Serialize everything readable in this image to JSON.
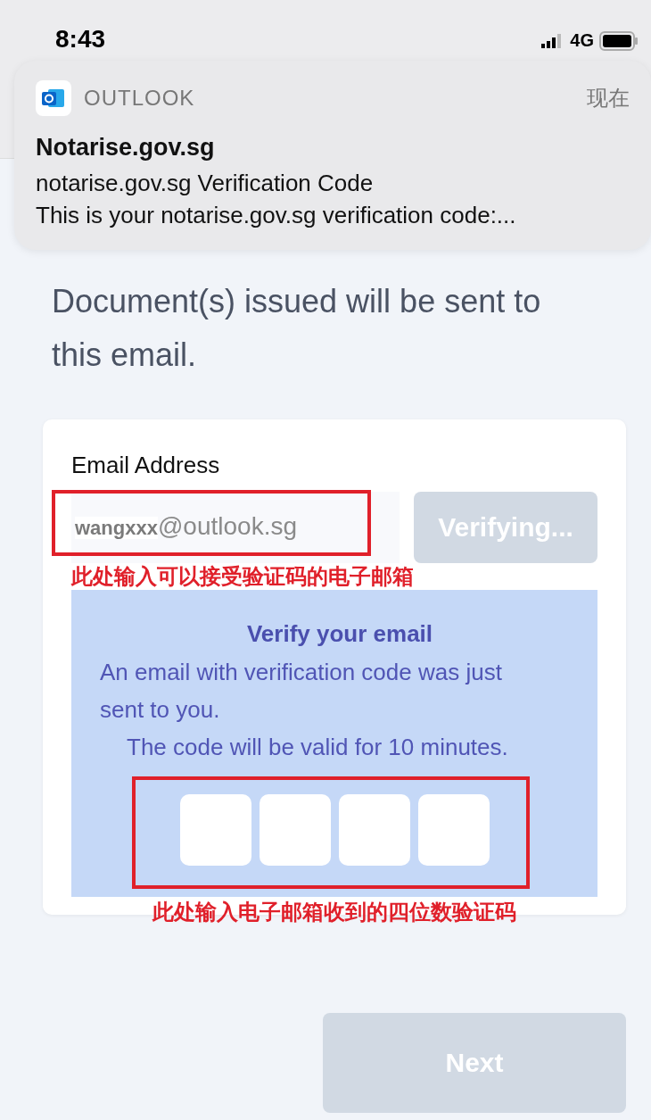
{
  "status_bar": {
    "time": "8:43",
    "network": "4G"
  },
  "notification": {
    "app": "OUTLOOK",
    "time": "现在",
    "title": "Notarise.gov.sg",
    "subject": "notarise.gov.sg Verification Code",
    "preview": "This is your notarise.gov.sg verification code:..."
  },
  "intro": "Document(s) issued will be sent to this email.",
  "email_form": {
    "label": "Email Address",
    "value": "**wangxxx**@outlook.sg",
    "button": {
      "label": "Verifying...",
      "disabled": true
    },
    "verify_panel": {
      "title": "Verify your email",
      "message": "An email with verification code was just sent to you.",
      "validity": "The code will be valid for 10 minutes."
    }
  },
  "annotations": [
    {
      "text": "此处输入可以接受验证码的电子邮箱"
    },
    {
      "text": "此处输入电子邮箱收到的四位数验证码"
    }
  ],
  "next_button": {
    "label": "Next",
    "disabled": true
  }
}
